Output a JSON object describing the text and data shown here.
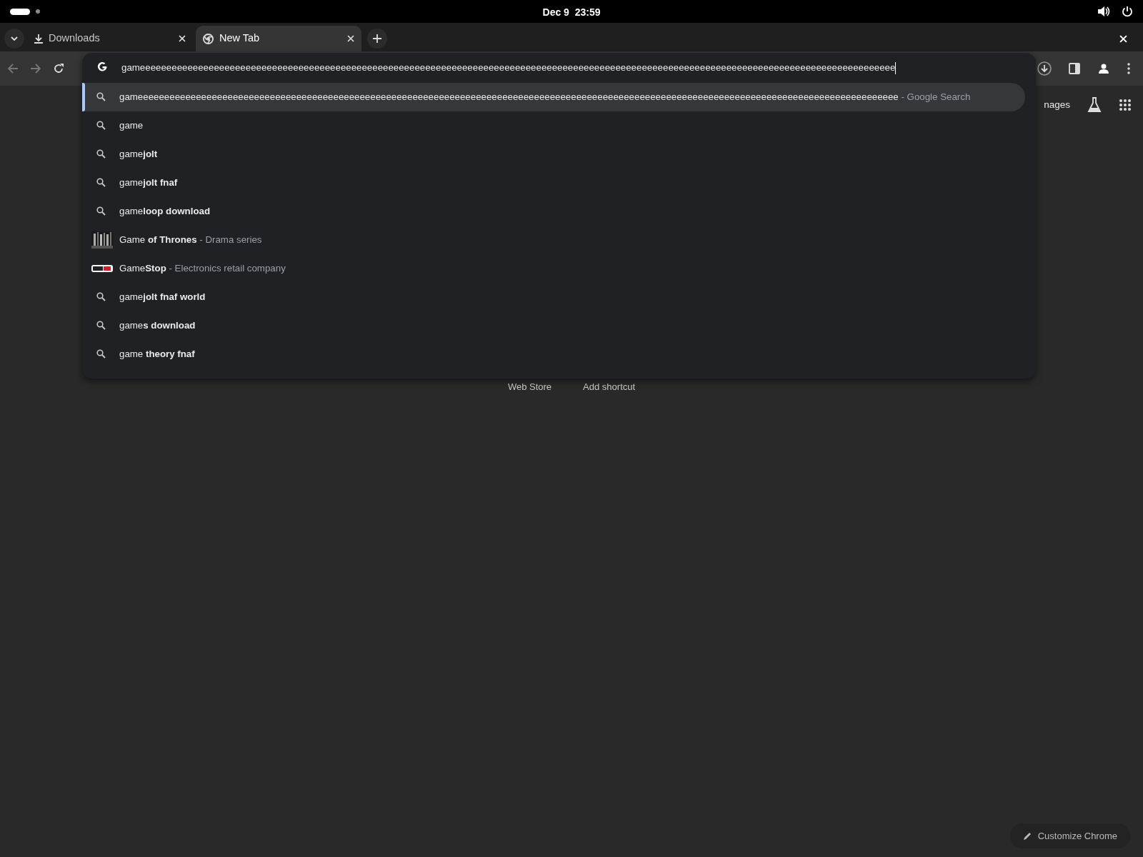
{
  "system_bar": {
    "date": "Dec 9",
    "time": "23:59"
  },
  "tabs": [
    {
      "title": "Downloads",
      "kind": "download",
      "selected": false
    },
    {
      "title": "New Tab",
      "kind": "chrome",
      "selected": true
    }
  ],
  "omnibox": {
    "value": "gameeeeeeeeeeeeeeeeeeeeeeeeeeeeeeeeeeeeeeeeeeeeeeeeeeeeeeeeeeeeeeeeeeeeeeeeeeeeeeeeeeeeeeeeeeeeeeeeeeeeeeeeeeeeeeeeeeeeeeeeeeeeeeeeeeeeeeeeeeeeeee",
    "suggestions": [
      {
        "kind": "search",
        "text": "gameeeeeeeeeeeeeeeeeeeeeeeeeeeeeeeeeeeeeeeeeeeeeeeeeeeeeeeeeeeeeeeeeeeeeeeeeeeeeeeeeeeeeeeeeeeeeeeeeeeeeeeeeeeeeeeeeeeeeeeeeeeeeeeeeeeeeeeeeeeeeeee",
        "detail": "- Google Search",
        "selected": true
      },
      {
        "kind": "search",
        "text": "game",
        "selected": false
      },
      {
        "kind": "search",
        "text": "game**jolt**",
        "selected": false
      },
      {
        "kind": "search",
        "text": "game**jolt fnaf**",
        "selected": false
      },
      {
        "kind": "search",
        "text": "game**loop download**",
        "selected": false
      },
      {
        "kind": "poster",
        "text": "Game **of Thrones**",
        "detail": "- Drama series",
        "selected": false
      },
      {
        "kind": "logo",
        "text": "Game**Stop**",
        "detail": "- Electronics retail company",
        "selected": false
      },
      {
        "kind": "search",
        "text": "game**jolt fnaf world**",
        "selected": false
      },
      {
        "kind": "search",
        "text": "game**s download**",
        "selected": false
      },
      {
        "kind": "search",
        "text": "game **theory fnaf**",
        "selected": false
      }
    ]
  },
  "page": {
    "images_link": "nages",
    "links": [
      "Web Store",
      "Add shortcut"
    ],
    "customize_button": "Customize Chrome"
  }
}
